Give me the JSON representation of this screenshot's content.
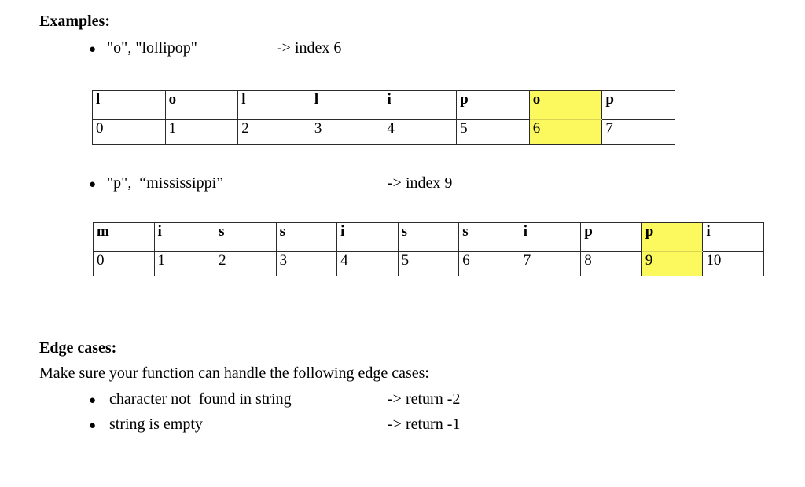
{
  "document": {
    "examples_heading": "Examples:",
    "examples": [
      {
        "bullet": "●",
        "prompt": "\"o\", \"lollipop\"",
        "result": "-> index 6"
      },
      {
        "bullet": "●",
        "prompt": "\"p\",  “mississippi”",
        "result": "-> index 9"
      }
    ],
    "tables": [
      {
        "name": "lollipop-index-table",
        "letters": [
          "l",
          "o",
          "l",
          "l",
          "i",
          "p",
          "o",
          "p"
        ],
        "indices": [
          "0",
          "1",
          "2",
          "3",
          "4",
          "5",
          "6",
          "7"
        ],
        "highlight_index": 6,
        "highlight_color": "#fbf95e"
      },
      {
        "name": "mississippi-index-table",
        "letters": [
          "m",
          "i",
          "s",
          "s",
          "i",
          "s",
          "s",
          "i",
          "p",
          "p",
          "i"
        ],
        "indices": [
          "0",
          "1",
          "2",
          "3",
          "4",
          "5",
          "6",
          "7",
          "8",
          "9",
          "10"
        ],
        "highlight_index": 9,
        "highlight_color": "#fbf95e"
      }
    ],
    "edge_cases_heading": "Edge cases:",
    "edge_cases_intro": "Make sure your function can handle the following edge cases:",
    "edge_cases": [
      {
        "bullet": "●",
        "prompt": "character not  found in string",
        "result": "-> return -2"
      },
      {
        "bullet": "●",
        "prompt": "string is empty",
        "result": "-> return -1"
      }
    ]
  }
}
